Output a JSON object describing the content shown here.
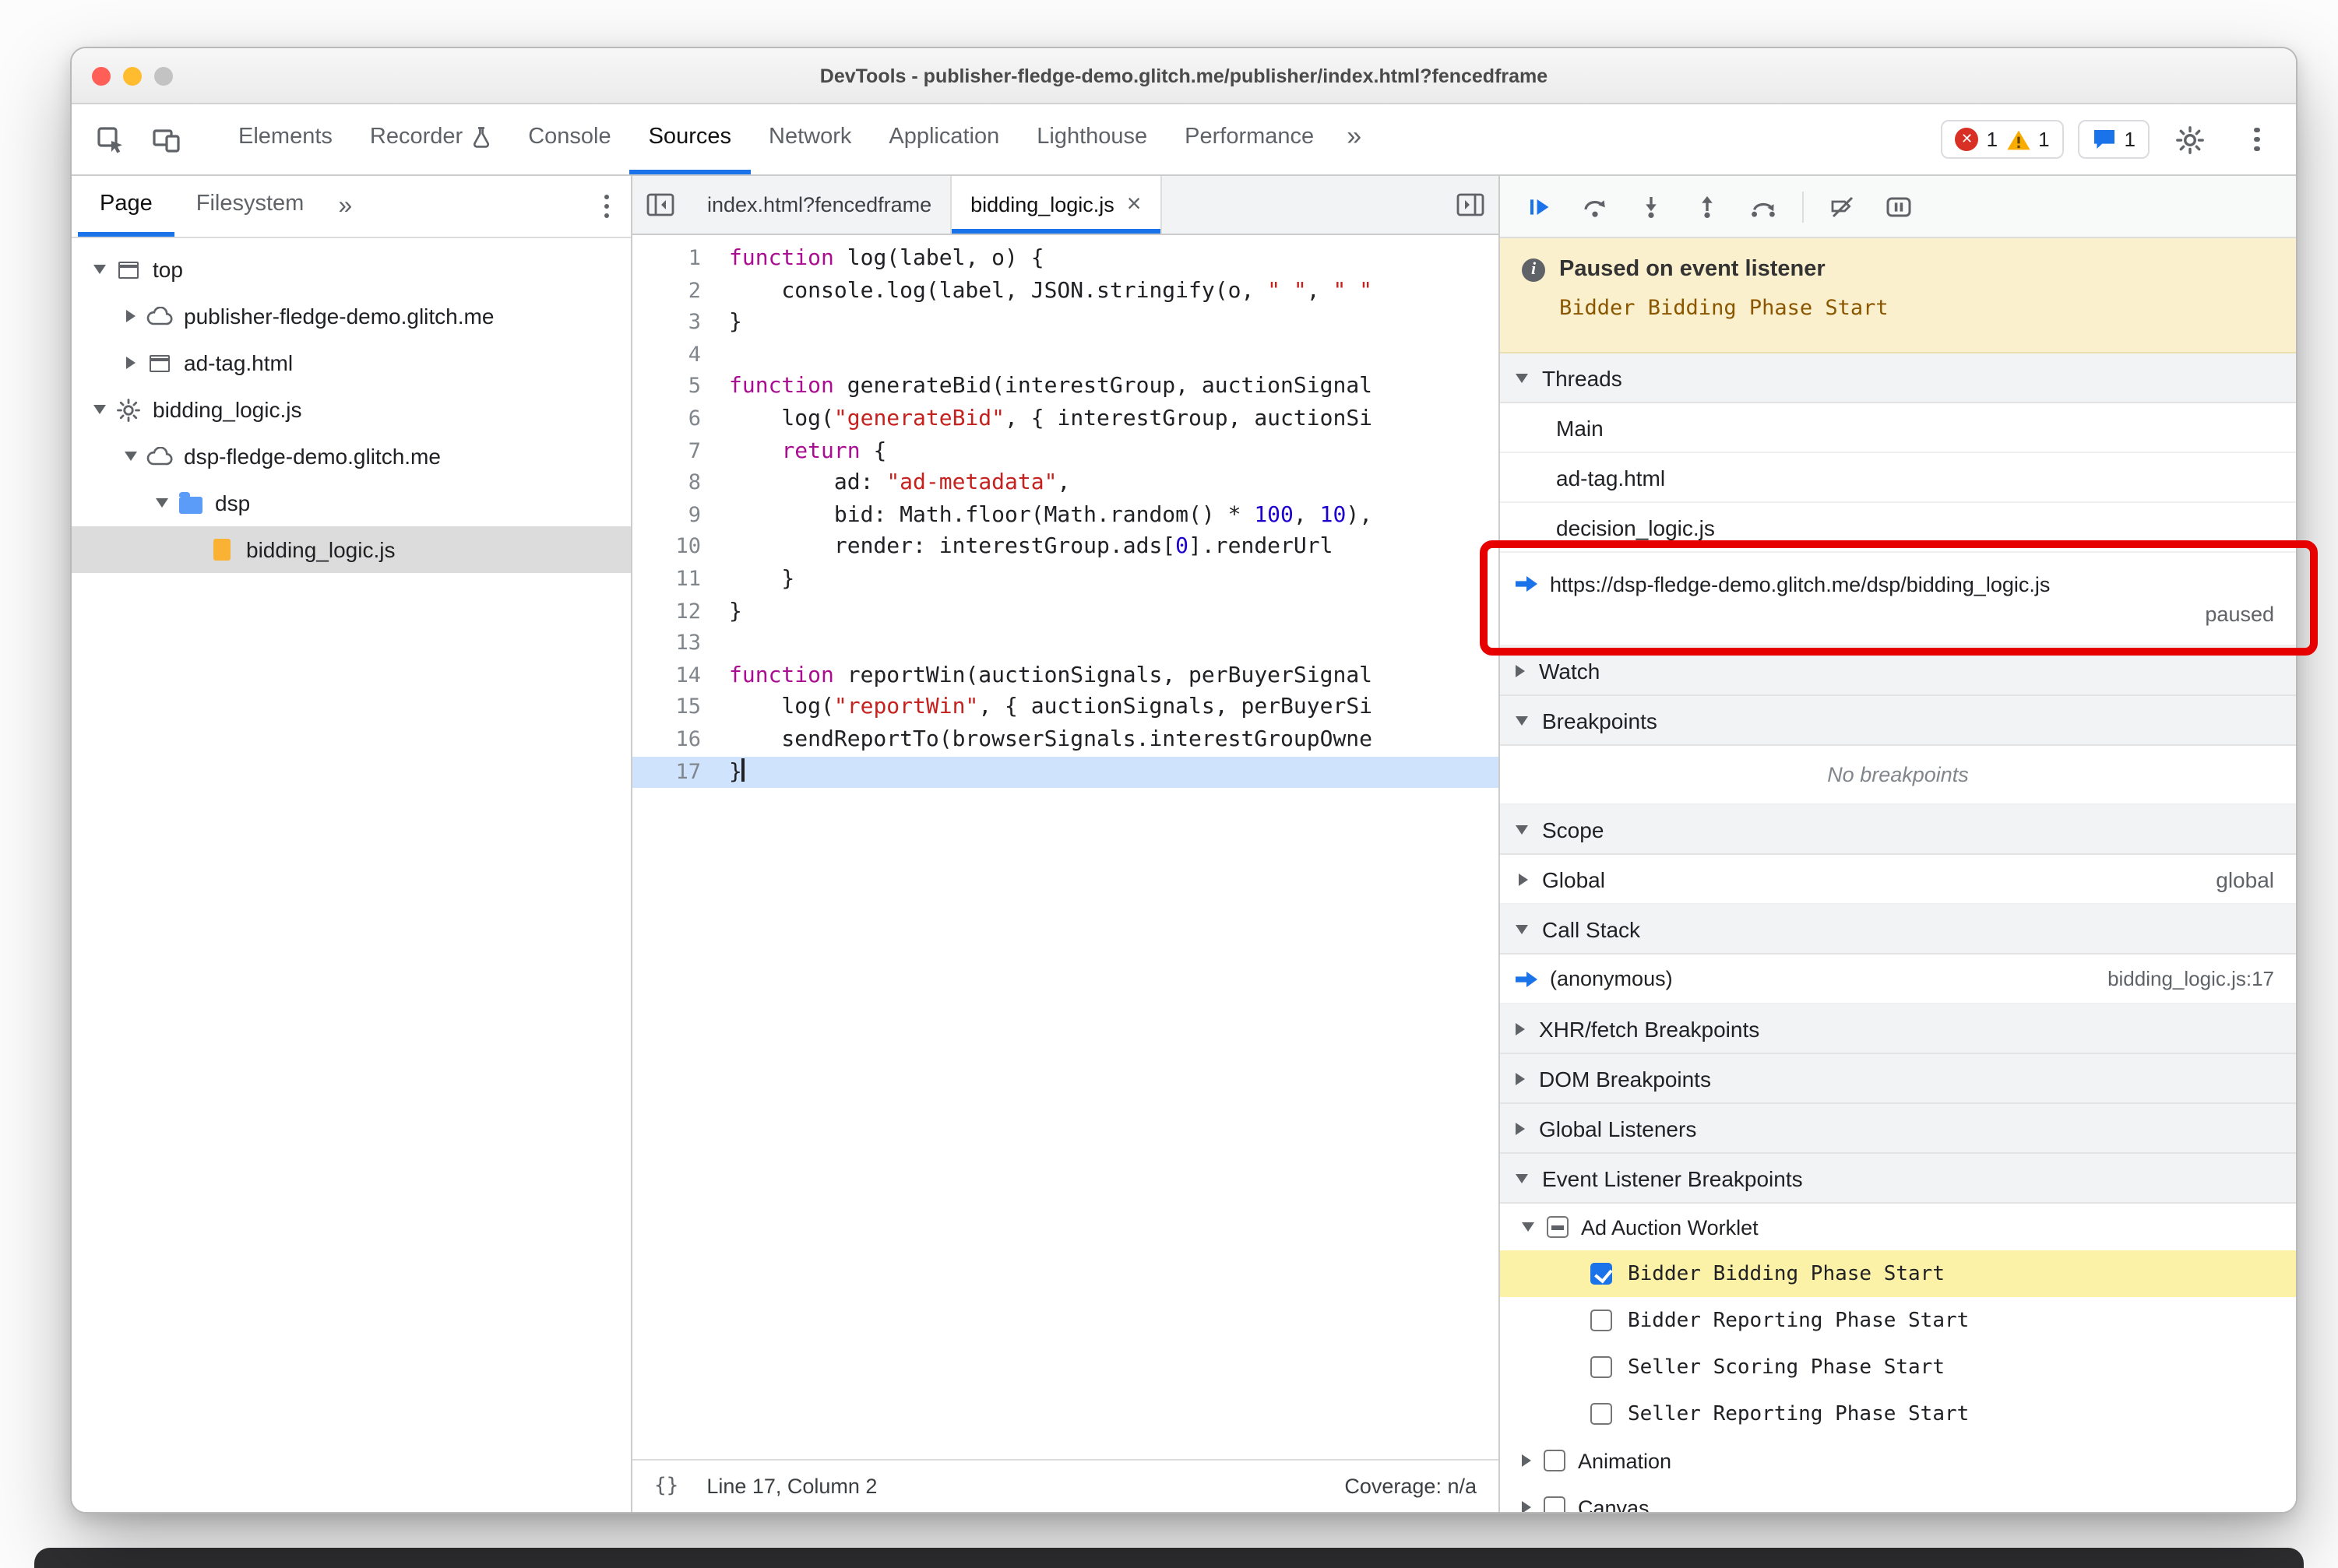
{
  "colors": {
    "accent": "#1a73e8",
    "error": "#d93025",
    "warning": "#f9ab00",
    "annotation_box": "#e60000",
    "paused_banner_bg": "#fbf0ce",
    "selected_breakpoint_row": "#fbf1a7"
  },
  "window": {
    "title": "DevTools - publisher-fledge-demo.glitch.me/publisher/index.html?fencedframe"
  },
  "toolbar": {
    "tabs": [
      "Elements",
      "Recorder",
      "Console",
      "Sources",
      "Network",
      "Application",
      "Lighthouse",
      "Performance"
    ],
    "active_tab": "Sources",
    "more_tabs_symbol": "»",
    "error_count": "1",
    "warning_count": "1",
    "issue_count": "1"
  },
  "navigator": {
    "tabs": [
      "Page",
      "Filesystem"
    ],
    "more_tabs_symbol": "»",
    "tree": [
      {
        "label": "top"
      },
      {
        "label": "publisher-fledge-demo.glitch.me"
      },
      {
        "label": "ad-tag.html"
      },
      {
        "label": "bidding_logic.js"
      },
      {
        "label": "dsp-fledge-demo.glitch.me"
      },
      {
        "label": "dsp"
      },
      {
        "label": "bidding_logic.js"
      }
    ]
  },
  "editor": {
    "tabs": [
      {
        "label": "index.html?fencedframe"
      },
      {
        "label": "bidding_logic.js",
        "close": "×"
      }
    ],
    "lines": [
      {
        "s": [
          {
            "t": "function",
            "c": "k"
          },
          {
            "t": " log(label, o) {",
            "c": "d"
          }
        ]
      },
      {
        "s": [
          {
            "t": "    console.log(label, JSON.stringify(o, ",
            "c": "d"
          },
          {
            "t": "\" \"",
            "c": "s"
          },
          {
            "t": ", ",
            "c": "d"
          },
          {
            "t": "\" \"",
            "c": "s"
          }
        ]
      },
      {
        "s": [
          {
            "t": "}",
            "c": "d"
          }
        ]
      },
      {
        "s": []
      },
      {
        "s": [
          {
            "t": "function",
            "c": "k"
          },
          {
            "t": " generateBid(interestGroup, auctionSignal",
            "c": "d"
          }
        ]
      },
      {
        "s": [
          {
            "t": "    log(",
            "c": "d"
          },
          {
            "t": "\"generateBid\"",
            "c": "s"
          },
          {
            "t": ", { interestGroup, auctionSi",
            "c": "d"
          }
        ]
      },
      {
        "s": [
          {
            "t": "    ",
            "c": "d"
          },
          {
            "t": "return",
            "c": "k"
          },
          {
            "t": " {",
            "c": "d"
          }
        ]
      },
      {
        "s": [
          {
            "t": "        ad: ",
            "c": "d"
          },
          {
            "t": "\"ad-metadata\"",
            "c": "s"
          },
          {
            "t": ",",
            "c": "d"
          }
        ]
      },
      {
        "s": [
          {
            "t": "        bid: Math.floor(Math.random() * ",
            "c": "d"
          },
          {
            "t": "100",
            "c": "n"
          },
          {
            "t": ", ",
            "c": "d"
          },
          {
            "t": "10",
            "c": "n"
          },
          {
            "t": "),",
            "c": "d"
          }
        ]
      },
      {
        "s": [
          {
            "t": "        render: interestGroup.ads[",
            "c": "d"
          },
          {
            "t": "0",
            "c": "n"
          },
          {
            "t": "].renderUrl",
            "c": "d"
          }
        ]
      },
      {
        "s": [
          {
            "t": "    }",
            "c": "d"
          }
        ]
      },
      {
        "s": [
          {
            "t": "}",
            "c": "d"
          }
        ]
      },
      {
        "s": []
      },
      {
        "s": [
          {
            "t": "function",
            "c": "k"
          },
          {
            "t": " reportWin(auctionSignals, perBuyerSignal",
            "c": "d"
          }
        ]
      },
      {
        "s": [
          {
            "t": "    log(",
            "c": "d"
          },
          {
            "t": "\"reportWin\"",
            "c": "s"
          },
          {
            "t": ", { auctionSignals, perBuyerSi",
            "c": "d"
          }
        ]
      },
      {
        "s": [
          {
            "t": "    sendReportTo(browserSignals.interestGroupOwne",
            "c": "d"
          }
        ]
      },
      {
        "s": [
          {
            "t": "}",
            "c": "d"
          }
        ],
        "hl": true,
        "caret": true
      }
    ],
    "status": {
      "pretty_print": "{}",
      "line_col": "Line 17, Column 2",
      "coverage": "Coverage: n/a"
    }
  },
  "debugger": {
    "paused_banner": {
      "title": "Paused on event listener",
      "detail": "Bidder Bidding Phase Start"
    },
    "threads": {
      "title": "Threads",
      "items": [
        "Main",
        "ad-tag.html",
        "decision_logic.js"
      ],
      "paused_thread": {
        "url": "https://dsp-fledge-demo.glitch.me/dsp/bidding_logic.js",
        "status": "paused"
      }
    },
    "watch": {
      "title": "Watch"
    },
    "breakpoints": {
      "title": "Breakpoints",
      "empty_message": "No breakpoints"
    },
    "scope": {
      "title": "Scope",
      "rows": [
        {
          "label": "Global",
          "value": "global"
        }
      ]
    },
    "call_stack": {
      "title": "Call Stack",
      "frames": [
        {
          "name": "(anonymous)",
          "location": "bidding_logic.js:17"
        }
      ]
    },
    "xhr_breakpoints": {
      "title": "XHR/fetch Breakpoints"
    },
    "dom_breakpoints": {
      "title": "DOM Breakpoints"
    },
    "global_listeners": {
      "title": "Global Listeners"
    },
    "event_listener_breakpoints": {
      "title": "Event Listener Breakpoints",
      "groups": [
        {
          "label": "Ad Auction Worklet",
          "children": [
            {
              "label": "Bidder Bidding Phase Start"
            },
            {
              "label": "Bidder Reporting Phase Start"
            },
            {
              "label": "Seller Scoring Phase Start"
            },
            {
              "label": "Seller Reporting Phase Start"
            }
          ]
        },
        {
          "label": "Animation"
        },
        {
          "label": "Canvas"
        }
      ]
    }
  }
}
